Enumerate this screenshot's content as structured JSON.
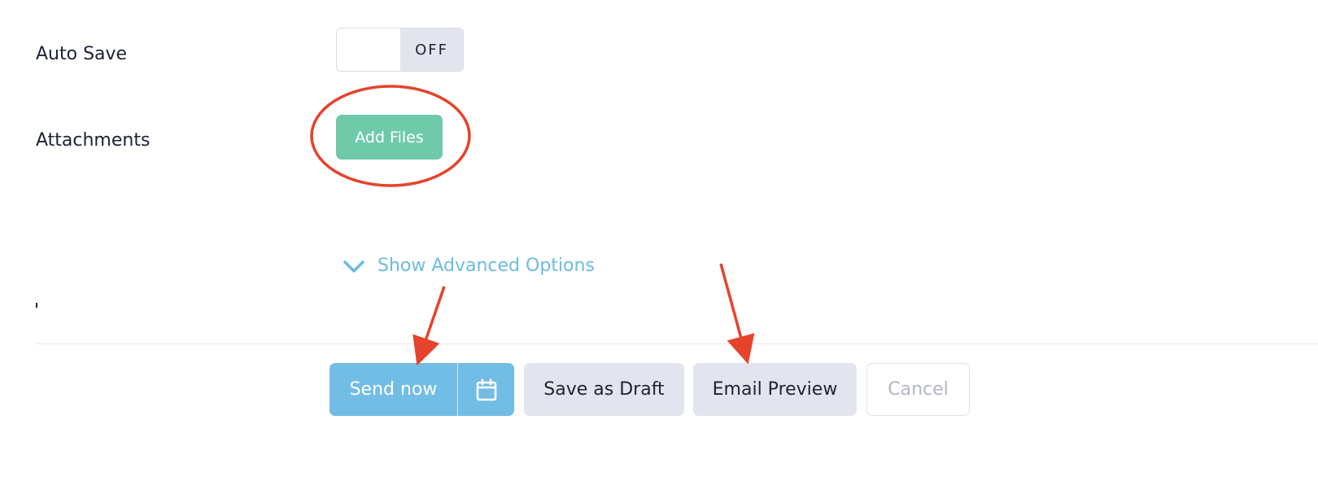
{
  "settings": {
    "auto_save": {
      "label": "Auto Save",
      "state": "OFF"
    },
    "attachments": {
      "label": "Attachments",
      "add_files_label": "Add Files"
    }
  },
  "advanced": {
    "label": "Show Advanced Options",
    "icon": "chevron-down-icon"
  },
  "actions": {
    "send_now_label": "Send now",
    "schedule_icon": "calendar-icon",
    "save_draft_label": "Save as Draft",
    "email_preview_label": "Email Preview",
    "cancel_label": "Cancel"
  },
  "colors": {
    "accent_green": "#6fcaa9",
    "accent_blue": "#72bde6",
    "link_blue": "#6cbbe4",
    "annotation_red": "#e5432b"
  }
}
